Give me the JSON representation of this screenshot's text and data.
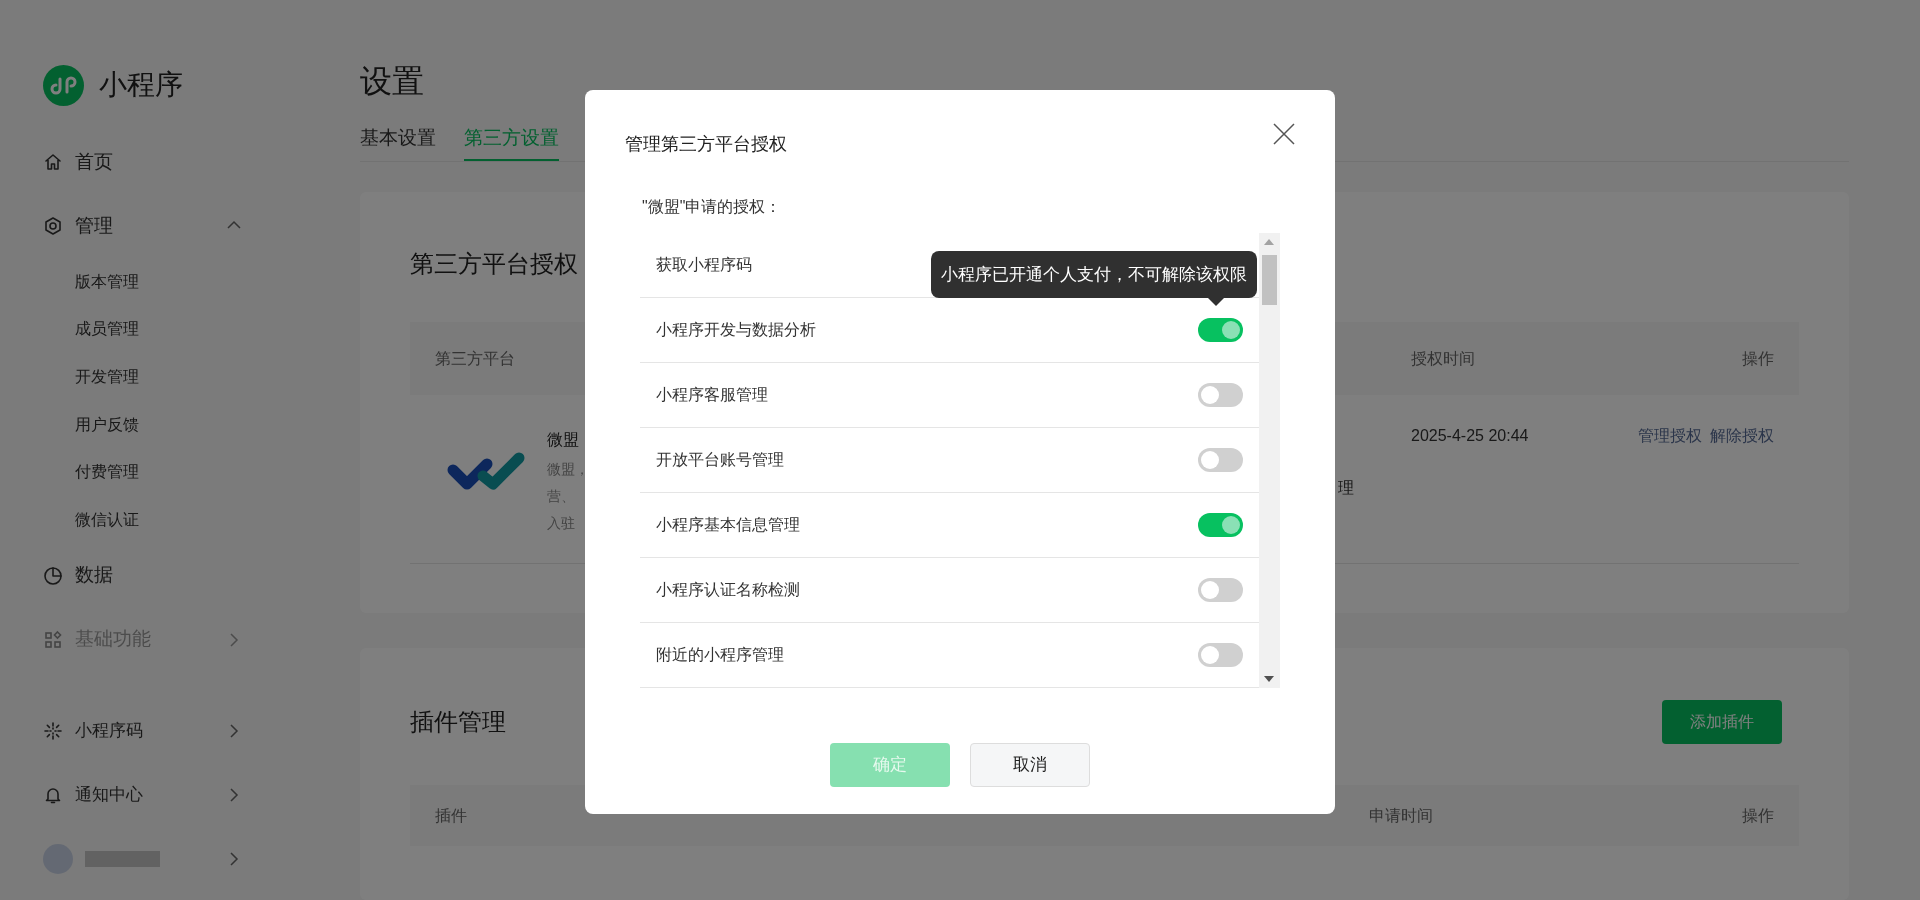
{
  "sidebar": {
    "logo_text": "小程序",
    "groups": [
      [
        {
          "label": "首页",
          "kind": "link",
          "disabled": false
        },
        {
          "label": "管理",
          "kind": "link",
          "disabled": false,
          "expanded": true,
          "children": [
            {
              "label": "版本管理"
            },
            {
              "label": "成员管理"
            },
            {
              "label": "开发管理"
            },
            {
              "label": "用户反馈"
            },
            {
              "label": "付费管理"
            },
            {
              "label": "微信认证"
            }
          ]
        },
        {
          "label": "数据",
          "kind": "link",
          "disabled": false
        },
        {
          "label": "基础功能",
          "kind": "link",
          "disabled": true,
          "expanded": false
        }
      ],
      [
        {
          "label": "小程序码",
          "kind": "link",
          "disabled": false,
          "expanded": false
        },
        {
          "label": "通知中心",
          "kind": "link",
          "disabled": false,
          "expanded": false
        },
        {
          "kind": "account",
          "disabled": false,
          "expanded": false
        }
      ]
    ]
  },
  "page_title": "设置",
  "tabs": [
    {
      "label": "基本设置",
      "selected": false
    },
    {
      "label": "第三方设置",
      "selected": true
    }
  ],
  "auth_card": {
    "title": "第三方平台授权",
    "columns": [
      "第三方平台",
      "授权时间",
      "操作"
    ],
    "rows": [
      {
        "name": "微盟",
        "description_lines": [
          "微盟，",
          "营、",
          "入驻"
        ],
        "column_2": "理",
        "time": "2025-4-25 20:44",
        "actions": [
          "管理授权",
          "解除授权"
        ]
      }
    ]
  },
  "plugin_card": {
    "title": "插件管理",
    "add_button": "添加插件",
    "columns": [
      "插件",
      "申请时间",
      "操作"
    ]
  },
  "modal": {
    "title": "管理第三方平台授权",
    "subtitle": "\"微盟\"申请的授权：",
    "permissions": [
      {
        "label": "获取小程序码",
        "kind": "covered"
      },
      {
        "label": "小程序开发与数据分析",
        "kind": "toggle",
        "on": true
      },
      {
        "label": "小程序客服管理",
        "kind": "toggle",
        "on": false
      },
      {
        "label": "开放平台账号管理",
        "kind": "toggle",
        "on": false
      },
      {
        "label": "小程序基本信息管理",
        "kind": "toggle",
        "on": true
      },
      {
        "label": "小程序认证名称检测",
        "kind": "toggle",
        "on": false
      },
      {
        "label": "附近的小程序管理",
        "kind": "toggle",
        "on": false
      }
    ],
    "tooltip": "小程序已开通个人支付，不可解除该权限",
    "buttons": [
      {
        "label": "确定",
        "kind": "primary",
        "disabled": true
      },
      {
        "label": "取消",
        "kind": "secondary",
        "disabled": false
      }
    ]
  }
}
